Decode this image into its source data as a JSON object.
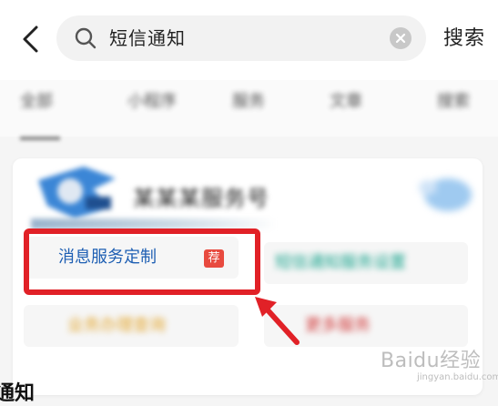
{
  "header": {
    "back_icon": "chevron-left-icon",
    "search_query": "短信通知",
    "search_button": "搜索"
  },
  "tabs": {
    "items": [
      {
        "label": "全部"
      },
      {
        "label": "小程序"
      },
      {
        "label": "服务"
      },
      {
        "label": "文章"
      },
      {
        "label": "搜索"
      }
    ]
  },
  "card": {
    "title": "某某某服务号",
    "services": [
      {
        "label": "消息服务定制",
        "badge": "荐"
      },
      {
        "label": "短信通知服务设置"
      },
      {
        "label": "业务办理查询"
      },
      {
        "label": "更多服务"
      }
    ]
  },
  "watermark": {
    "main": "Baidu经验",
    "sub": "jingyan.baidu.com"
  },
  "section": {
    "title": "通知"
  },
  "colors": {
    "accent_blue": "#1e5fb3",
    "highlight_red": "#e12127",
    "badge_red": "#e84a3f"
  }
}
